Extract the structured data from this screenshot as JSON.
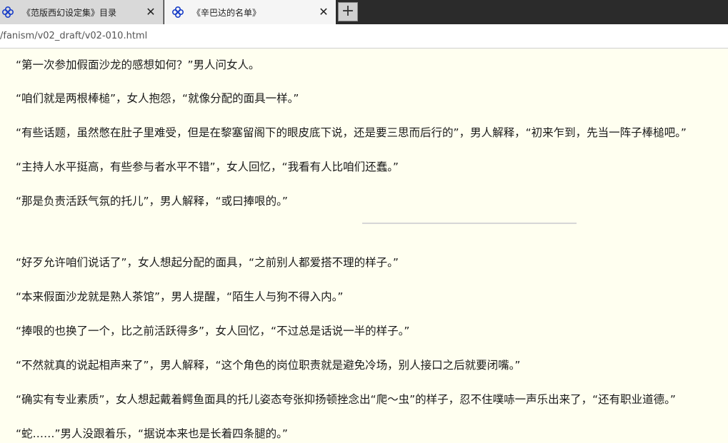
{
  "browser": {
    "tabs": [
      {
        "title": "《范版西幻设定集》目录",
        "close": "✕",
        "favicon": "favicon-icon"
      },
      {
        "title": "《辛巴达的名单》",
        "close": "✕",
        "favicon": "favicon-icon"
      }
    ],
    "new_tab_label": "+",
    "url": "/fanism/v02_draft/v02-010.html"
  },
  "article": {
    "paragraphs": [
      "“第一次参加假面沙龙的感想如何？”男人问女人。",
      "“咱们就是两根棒槌”，女人抱怨，“就像分配的面具一样。”",
      "“有些话题，虽然憋在肚子里难受，但是在黎塞留阁下的眼皮底下说，还是要三思而后行的”，男人解释，“初来乍到，先当一阵子棒槌吧。”",
      "“主持人水平挺高，有些参与者水平不错”，女人回忆，“我看有人比咱们还蠢。”",
      "“那是负责活跃气氛的托儿”，男人解释，“或曰捧哏的。”",
      "“好歹允许咱们说话了”，女人想起分配的面具，“之前别人都爱搭不理的样子。”",
      "“本来假面沙龙就是熟人茶馆”，男人提醒，“陌生人与狗不得入内。”",
      "“捧哏的也换了一个，比之前活跃得多”，女人回忆，“不过总是话说一半的样子。”",
      "“不然就真的说起相声来了”，男人解释，“这个角色的岗位职责就是避免冷场，别人接口之后就要闭嘴。”",
      "“确实有专业素质”，女人想起戴着鳄鱼面具的托儿姿态夸张抑扬顿挫念出“爬～虫”的样子，忍不住噗哧一声乐出来了，“还有职业道德。”",
      "“蛇……”男人没跟着乐，“据说本来也是长着四条腿的。”"
    ]
  }
}
